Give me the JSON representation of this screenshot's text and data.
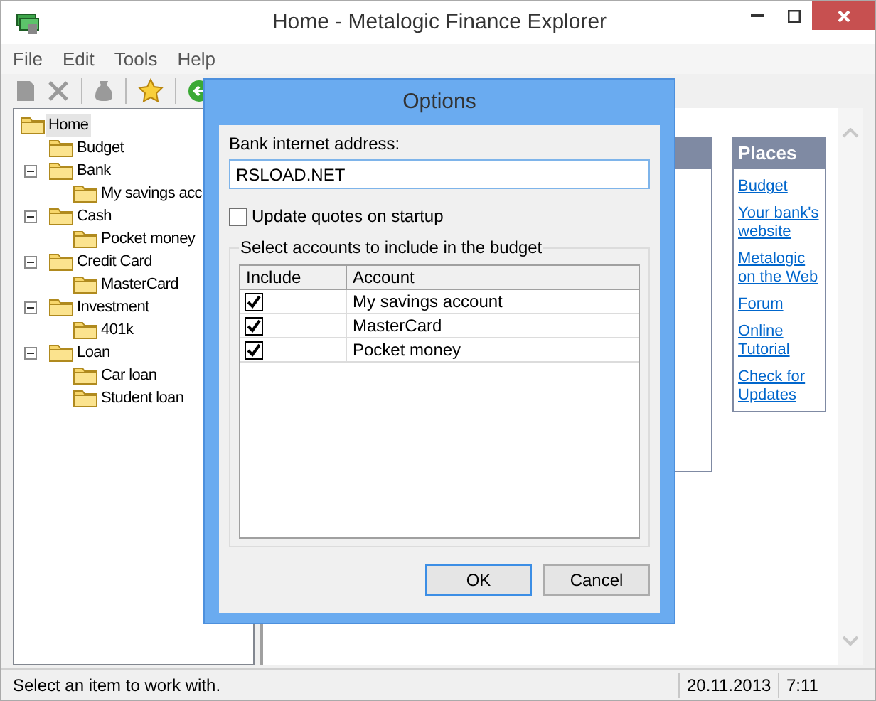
{
  "window": {
    "title": "Home - Metalogic Finance Explorer"
  },
  "menu": [
    "File",
    "Edit",
    "Tools",
    "Help"
  ],
  "tree": [
    {
      "label": "Home",
      "selected": true,
      "children": [
        {
          "label": "Budget",
          "selected": false
        },
        {
          "label": "Bank",
          "selected": false,
          "expanded": true,
          "children": [
            {
              "label": "My savings acc",
              "selected": false
            }
          ]
        },
        {
          "label": "Cash",
          "selected": false,
          "expanded": true,
          "children": [
            {
              "label": "Pocket money",
              "selected": false
            }
          ]
        },
        {
          "label": "Credit Card",
          "selected": false,
          "expanded": true,
          "children": [
            {
              "label": "MasterCard",
              "selected": false
            }
          ]
        },
        {
          "label": "Investment",
          "selected": false,
          "expanded": true,
          "children": [
            {
              "label": "401k",
              "selected": false
            }
          ]
        },
        {
          "label": "Loan",
          "selected": false,
          "expanded": true,
          "children": [
            {
              "label": "Car loan",
              "selected": false
            },
            {
              "label": "Student loan",
              "selected": false
            }
          ]
        }
      ]
    }
  ],
  "places": {
    "title": "Places",
    "links": [
      "Budget",
      "Your bank's website",
      "Metalogic on the Web",
      "Forum",
      "Online Tutorial",
      "Check for Updates"
    ]
  },
  "dialog": {
    "title": "Options",
    "address_label": "Bank internet address:",
    "address_value": "RSLOAD.NET",
    "update_quotes": {
      "label": "Update quotes on startup",
      "checked": false
    },
    "group_title": "Select accounts to include in the budget",
    "columns": [
      "Include",
      "Account"
    ],
    "rows": [
      {
        "include": true,
        "account": "My savings account"
      },
      {
        "include": true,
        "account": "MasterCard"
      },
      {
        "include": true,
        "account": "Pocket money"
      }
    ],
    "buttons": [
      "OK",
      "Cancel"
    ]
  },
  "status_bar": {
    "message": "Select an item to work with.",
    "date": "20.11.2013",
    "time": "7:11"
  }
}
